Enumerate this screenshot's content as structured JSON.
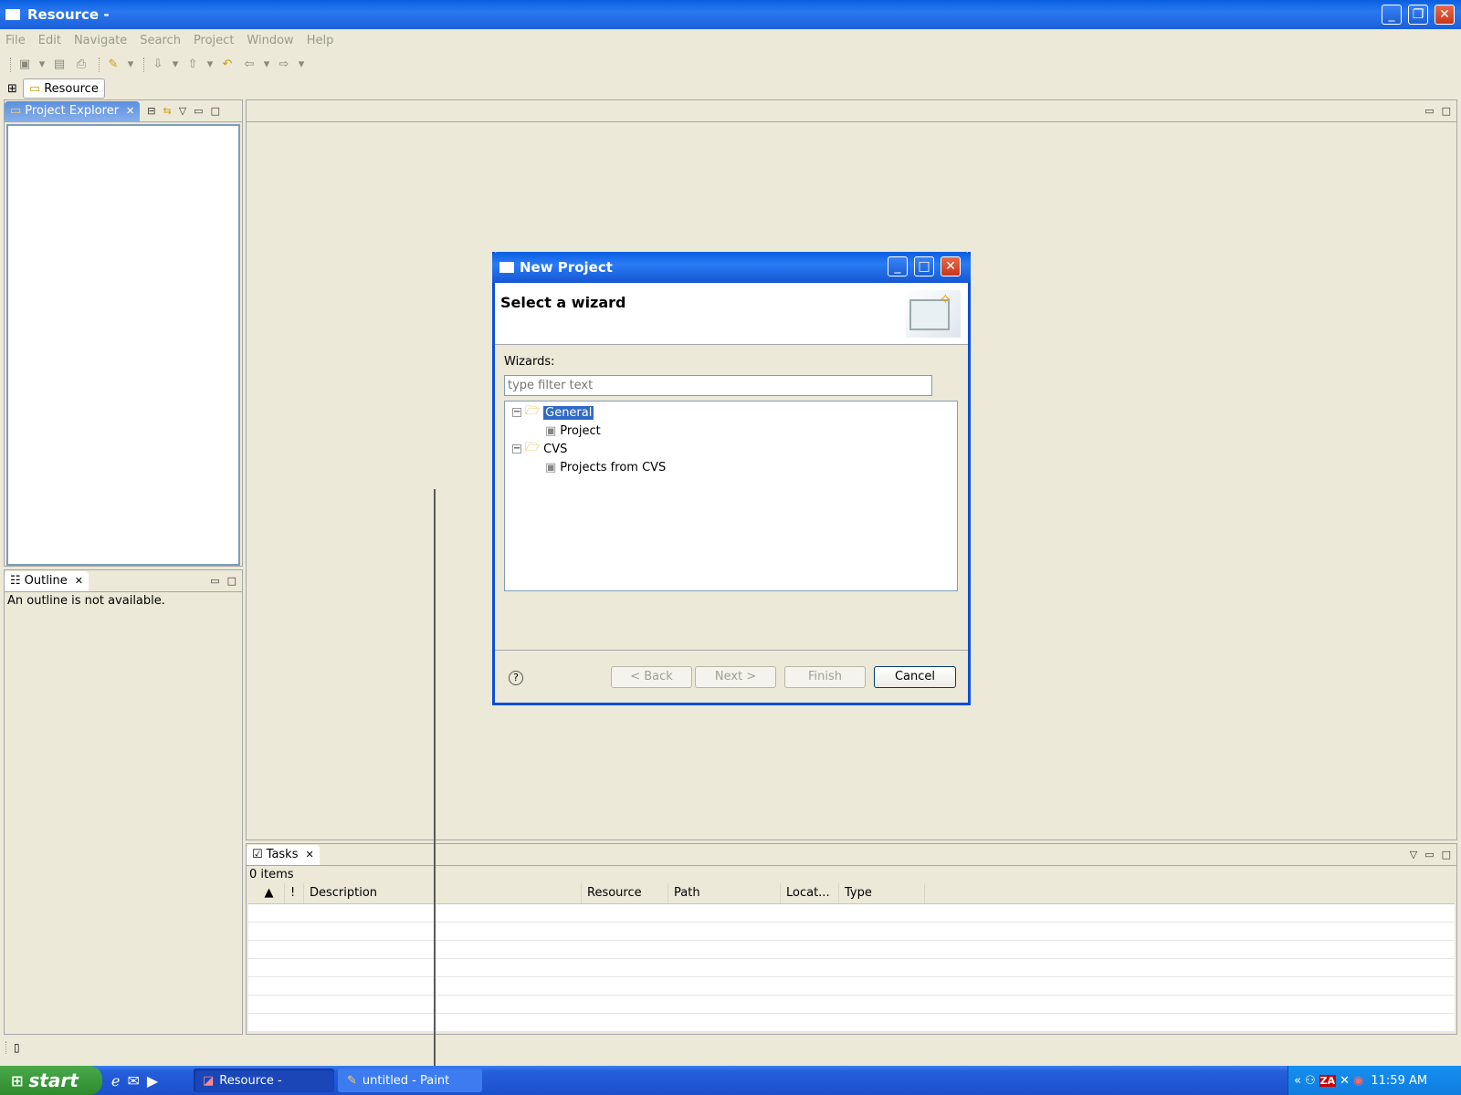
{
  "window": {
    "title": "Resource -",
    "min": "_",
    "max": "❐",
    "close": "✕"
  },
  "menu": [
    "File",
    "Edit",
    "Navigate",
    "Search",
    "Project",
    "Window",
    "Help"
  ],
  "perspective": {
    "label": "Resource"
  },
  "project_explorer": {
    "tab": "Project Explorer",
    "close": "✕"
  },
  "outline": {
    "tab": "Outline",
    "close": "✕",
    "message": "An outline is not available."
  },
  "tasks": {
    "tab": "Tasks",
    "close": "✕",
    "count": "0 items",
    "columns": [
      "",
      "!",
      "Description",
      "Resource",
      "Path",
      "Locat...",
      "Type"
    ]
  },
  "dialog": {
    "title": "New Project",
    "heading": "Select a wizard",
    "wizards_label": "Wizards:",
    "filter_placeholder": "type filter text",
    "tree": [
      {
        "label": "General",
        "children": [
          "Project"
        ]
      },
      {
        "label": "CVS",
        "children": [
          "Projects from CVS"
        ]
      }
    ],
    "buttons": {
      "back": "< Back",
      "next": "Next >",
      "finish": "Finish",
      "cancel": "Cancel"
    },
    "help": "?"
  },
  "taskbar": {
    "start": "start",
    "tasks": [
      "Resource -",
      "untitled - Paint"
    ],
    "clock": "11:59 AM"
  },
  "colors": {
    "xp_blue": "#245edb",
    "panel": "#ece9d8",
    "selection": "#316ac5"
  }
}
